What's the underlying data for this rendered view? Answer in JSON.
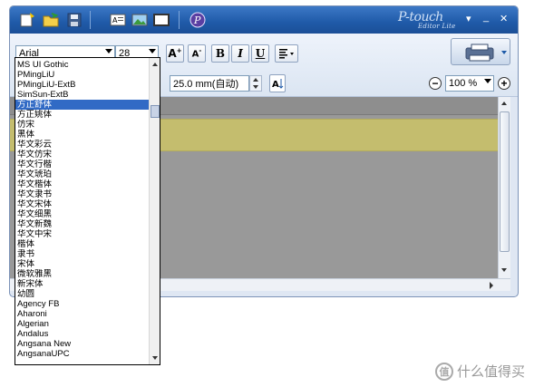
{
  "app": {
    "brand_main": "P-touch",
    "brand_sub": "Editor Lite",
    "minimize": "_",
    "close": "✕",
    "help": "▾"
  },
  "toolbar": {
    "font_value": "Arial",
    "size_value": "28",
    "length_value": "25.0 mm(自动)",
    "zoom_value": "100 %",
    "bold": "B",
    "italic": "I",
    "underline": "U"
  },
  "font_list": [
    "MS UI Gothic",
    "PMingLiU",
    "PMingLiU-ExtB",
    "SimSun-ExtB",
    "方正舒体",
    "方正姚体",
    "仿宋",
    "黑体",
    "华文彩云",
    "华文仿宋",
    "华文行楷",
    "华文琥珀",
    "华文楷体",
    "华文隶书",
    "华文宋体",
    "华文细黑",
    "华文新魏",
    "华文中宋",
    "楷体",
    "隶书",
    "宋体",
    "微软雅黑",
    "新宋体",
    "幼圆",
    "Agency FB",
    "Aharoni",
    "Algerian",
    "Andalus",
    "Angsana New",
    "AngsanaUPC"
  ],
  "font_list_selected_index": 4,
  "watermark": {
    "badge": "值",
    "text": "什么值得买"
  },
  "colors": {
    "title_bar": "#1f5aa8",
    "selection": "#316ac5",
    "label_strip": "#c4bd6e",
    "canvas": "#999999"
  }
}
